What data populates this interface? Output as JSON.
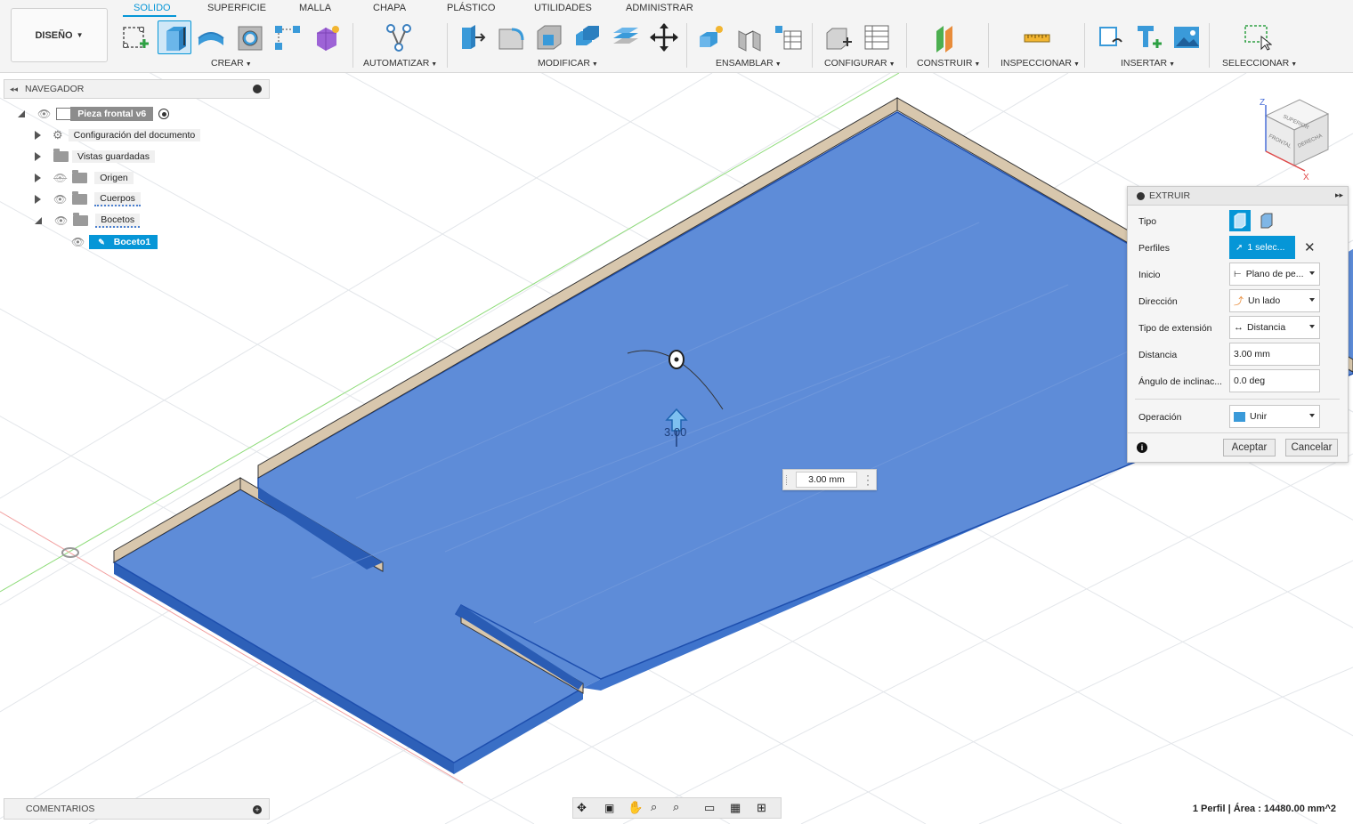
{
  "toolbar": {
    "workspace": "DISEÑO",
    "tabs": [
      {
        "label": "SOLIDO",
        "active": true
      },
      {
        "label": "SUPERFICIE",
        "active": false
      },
      {
        "label": "MALLA",
        "active": false
      },
      {
        "label": "CHAPA",
        "active": false
      },
      {
        "label": "PLÁSTICO",
        "active": false
      },
      {
        "label": "UTILIDADES",
        "active": false
      },
      {
        "label": "ADMINISTRAR",
        "active": false
      }
    ],
    "groups": [
      "CREAR",
      "AUTOMATIZAR",
      "MODIFICAR",
      "ENSAMBLAR",
      "CONFIGURAR",
      "CONSTRUIR",
      "INSPECCIONAR",
      "INSERTAR",
      "SELECCIONAR"
    ],
    "tools": [
      "create-sketch-icon",
      "extrude-icon",
      "revolve-icon",
      "hole-icon",
      "pattern-icon",
      "form-icon",
      "automate-icon",
      "press-pull-icon",
      "fillet-icon",
      "shell-icon",
      "combine-icon",
      "replace-face-icon",
      "move-icon",
      "new-component-icon",
      "joint-icon",
      "table-icon",
      "configure-icon",
      "configure-table-icon",
      "offset-plane-icon",
      "measure-icon",
      "insert-derive-icon",
      "insert-mcmaster-icon",
      "insert-image-icon",
      "select-window-icon"
    ]
  },
  "navigator": {
    "title": "NAVEGADOR",
    "root": "Pieza frontal v6",
    "items": [
      {
        "label": "Configuración del documento"
      },
      {
        "label": "Vistas guardadas"
      },
      {
        "label": "Origen"
      },
      {
        "label": "Cuerpos"
      },
      {
        "label": "Bocetos"
      },
      {
        "label": "Boceto1"
      }
    ]
  },
  "extrude": {
    "title": "EXTRUIR",
    "rows": {
      "tipo": {
        "label": "Tipo"
      },
      "perfiles": {
        "label": "Perfiles",
        "value": "1 selec..."
      },
      "inicio": {
        "label": "Inicio",
        "value": "Plano de pe..."
      },
      "direccion": {
        "label": "Dirección",
        "value": "Un lado"
      },
      "tipo_extension": {
        "label": "Tipo de extensión",
        "value": "Distancia"
      },
      "distancia": {
        "label": "Distancia",
        "value": "3.00 mm"
      },
      "angulo": {
        "label": "Ángulo de inclinac...",
        "value": "0.0 deg"
      },
      "operacion": {
        "label": "Operación",
        "value": "Unir"
      }
    },
    "ok": "Aceptar",
    "cancel": "Cancelar"
  },
  "viewport": {
    "dimension_input": "3.00 mm",
    "arrow_label": "3.00",
    "viewcube": {
      "top": "SUPERIOR",
      "front": "FRONTAL",
      "right": "DERECHA",
      "z": "Z",
      "x": "X"
    }
  },
  "comments": "COMENTARIOS",
  "status": "1 Perfil | Área : 14480.00 mm^2",
  "colors": {
    "accent": "#0696d7",
    "body_blue": "#4a7fcf",
    "plank": "#d8c7ad"
  }
}
